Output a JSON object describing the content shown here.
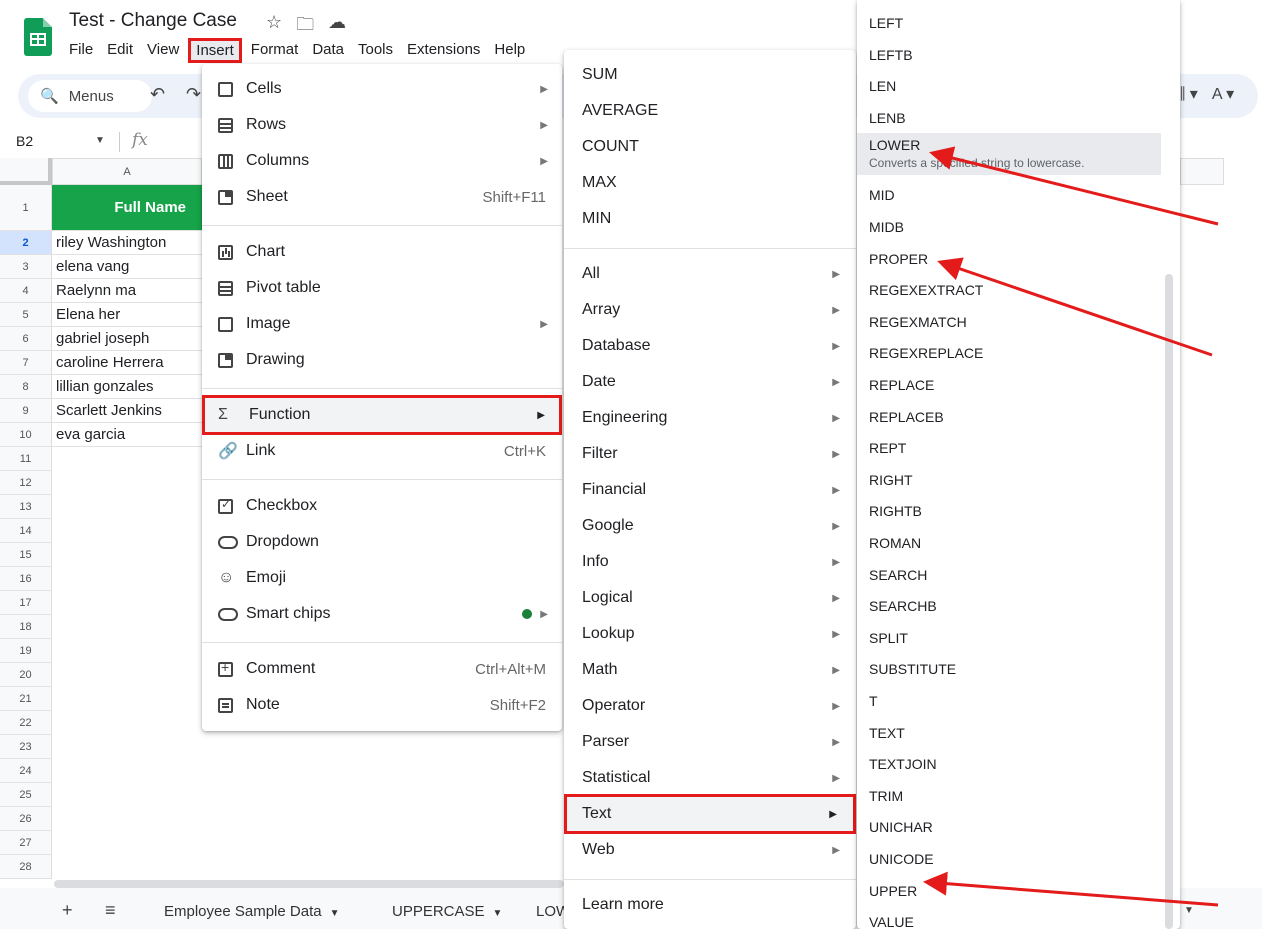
{
  "window": {
    "doc_title": "Test - Change Case"
  },
  "menubar": [
    "File",
    "Edit",
    "View",
    "Insert",
    "Format",
    "Data",
    "Tools",
    "Extensions",
    "Help"
  ],
  "toolbar": {
    "search_label": "Menus"
  },
  "formula_bar": {
    "name_box": "B2",
    "fx": "fx"
  },
  "grid": {
    "column_header": "A",
    "rows": [
      "1",
      "2",
      "3",
      "4",
      "5",
      "6",
      "7",
      "8",
      "9",
      "10",
      "11",
      "12",
      "13",
      "14",
      "15",
      "16",
      "17",
      "18",
      "19",
      "20",
      "21",
      "22",
      "23",
      "24",
      "25",
      "26",
      "27",
      "28"
    ],
    "selected_row": "2",
    "header_cell": "Full Name",
    "cells": [
      "riley Washington",
      "elena vang",
      "Raelynn ma",
      "Elena her",
      "gabriel joseph",
      "caroline Herrera",
      "lillian gonzales",
      "Scarlett Jenkins",
      "eva garcia"
    ]
  },
  "sheet_tabs": [
    "Employee Sample Data",
    "UPPERCASE",
    "LOW"
  ],
  "insert_menu": {
    "items": [
      {
        "label": "Cells",
        "shortcut": "",
        "submenu": true
      },
      {
        "label": "Rows",
        "shortcut": "",
        "submenu": true
      },
      {
        "label": "Columns",
        "shortcut": "",
        "submenu": true
      },
      {
        "label": "Sheet",
        "shortcut": "Shift+F11",
        "submenu": false
      },
      {
        "label": "Chart",
        "shortcut": "",
        "submenu": false
      },
      {
        "label": "Pivot table",
        "shortcut": "",
        "submenu": false
      },
      {
        "label": "Image",
        "shortcut": "",
        "submenu": true
      },
      {
        "label": "Drawing",
        "shortcut": "",
        "submenu": false
      },
      {
        "label": "Function",
        "shortcut": "",
        "submenu": true
      },
      {
        "label": "Link",
        "shortcut": "Ctrl+K",
        "submenu": false
      },
      {
        "label": "Checkbox",
        "shortcut": "",
        "submenu": false
      },
      {
        "label": "Dropdown",
        "shortcut": "",
        "submenu": false
      },
      {
        "label": "Emoji",
        "shortcut": "",
        "submenu": false
      },
      {
        "label": "Smart chips",
        "shortcut": "",
        "submenu": true
      },
      {
        "label": "Comment",
        "shortcut": "Ctrl+Alt+M",
        "submenu": false
      },
      {
        "label": "Note",
        "shortcut": "Shift+F2",
        "submenu": false
      }
    ]
  },
  "function_menu": {
    "common": [
      "SUM",
      "AVERAGE",
      "COUNT",
      "MAX",
      "MIN"
    ],
    "categories": [
      "All",
      "Array",
      "Database",
      "Date",
      "Engineering",
      "Filter",
      "Financial",
      "Google",
      "Info",
      "Logical",
      "Lookup",
      "Math",
      "Operator",
      "Parser",
      "Statistical",
      "Text",
      "Web"
    ],
    "learn_more": "Learn more"
  },
  "text_functions": {
    "items": [
      "LEFT",
      "LEFTB",
      "LEN",
      "LENB",
      "LOWER",
      "MID",
      "MIDB",
      "PROPER",
      "REGEXEXTRACT",
      "REGEXMATCH",
      "REGEXREPLACE",
      "REPLACE",
      "REPLACEB",
      "REPT",
      "RIGHT",
      "RIGHTB",
      "ROMAN",
      "SEARCH",
      "SEARCHB",
      "SPLIT",
      "SUBSTITUTE",
      "T",
      "TEXT",
      "TEXTJOIN",
      "TRIM",
      "UNICHAR",
      "UNICODE",
      "UPPER",
      "VALUE"
    ],
    "hover_description": "Converts a specified string to lowercase."
  },
  "colors": {
    "highlight_border": "#e41b1b",
    "header_fill": "#16a34a",
    "sheets_green": "#0f9d58",
    "annotation_arrow": "#e41b1b"
  }
}
